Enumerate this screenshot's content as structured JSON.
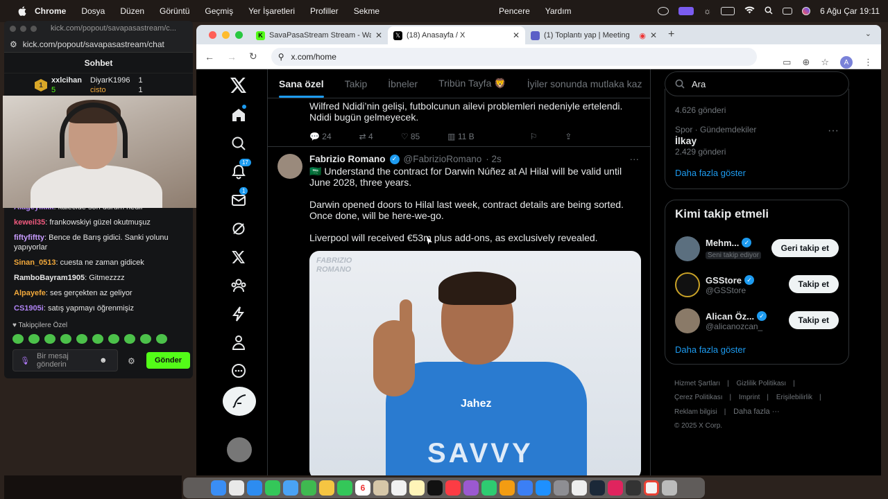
{
  "menubar": {
    "app": "Chrome",
    "items": [
      "Dosya",
      "Düzen",
      "Görüntü",
      "Geçmiş",
      "Yer İşaretleri",
      "Profiller",
      "Sekme"
    ],
    "right_items": [
      "Pencere",
      "Yardım"
    ],
    "datetime": "6 Ağu Çar  19:11"
  },
  "chat": {
    "window_title": "kick.com/popout/savapasastream/c...",
    "url": "kick.com/popout/savapasastream/chat",
    "header": "Sohbet",
    "leaderboard": [
      {
        "rank": "1",
        "name": "xxlcihan",
        "count": "5"
      },
      {
        "name": "DiyarK1996",
        "count": "1"
      },
      {
        "name": "cisto",
        "count": "1"
      }
    ],
    "messages": [
      {
        "user": "Alageyikkk",
        "text": "kalecide son durum nedir",
        "color": "#b084f5"
      },
      {
        "user": "keweil35",
        "text": "frankowskiyi güzel okutmuşuz",
        "color": "#f05a7e"
      },
      {
        "user": "fiftyfiftty",
        "text": "Bence de Barış gidici. Sanki yolunu yapıyorlar",
        "color": "#c89cff"
      },
      {
        "user": "Sinan_0513",
        "text": "cuesta ne zaman gidicek",
        "color": "#f2a93b"
      },
      {
        "user": "RamboBayram1905",
        "text": "Gitmezzzz",
        "color": "#e8e8e8"
      },
      {
        "user": "Alpayefe",
        "text": "ses gerçekten az geliyor",
        "color": "#f2a93b"
      },
      {
        "user": "CS1905i",
        "text": "satış yapmayı öğrenmişiz",
        "color": "#b084f5"
      }
    ],
    "followers_label": "Takipçilere Özel",
    "input_placeholder": "Bir mesaj gönderin",
    "send_label": "Gönder"
  },
  "browser": {
    "tabs": [
      {
        "title": "SavaPasaStream Stream - Wa",
        "icon": "kick-icon"
      },
      {
        "title": "(18) Anasayfa / X",
        "icon": "x-icon",
        "active": true
      },
      {
        "title": "(1) Toplantı yap | Meeting",
        "icon": "teams-icon"
      }
    ],
    "url": "x.com/home",
    "profile_initial": "A"
  },
  "x": {
    "nav_badges": {
      "notifications": "17",
      "messages": "1"
    },
    "feed_tabs": [
      "Sana özel",
      "Takip",
      "İbneler",
      "Tribün Tayfa 🦁",
      "İyiler sonunda mutlaka kaz"
    ],
    "prev_tweet": {
      "text": "Wilfred Ndidi’nin gelişi, futbolcunun ailevi problemleri nedeniyle ertelendi. Ndidi bugün gelmeyecek.",
      "replies": "24",
      "retweets": "4",
      "likes": "85",
      "views": "11 B"
    },
    "tweet": {
      "name": "Fabrizio Romano",
      "handle": "@FabrizioRomano",
      "time": "· 2s",
      "p1": "🇸🇦 Understand the contract for Darwin Núñez at Al Hilal will be valid until June 2028, three years.",
      "p2": "Darwin opened doors to Hilal last week, contract details are being sorted. Once done, will be here-we-go.",
      "p3": "Liverpool will received €53m plus add-ons, as exclusively revealed.",
      "watermark1": "FABRIZIO",
      "watermark2": "ROMANO",
      "jersey_text": "Jahez",
      "sponsor": "SAVVY"
    },
    "search_placeholder": "Ara",
    "trends": [
      {
        "count": "4.626 gönderi"
      },
      {
        "category": "Spor · Gündemdekiler",
        "name": "İlkay",
        "count": "2.429 gönderi"
      }
    ],
    "show_more": "Daha fazla göster",
    "who_to_follow": {
      "title": "Kimi takip etmeli",
      "people": [
        {
          "name": "Mehm...",
          "handle": "Seni takip ediyor",
          "button": "Geri takip et"
        },
        {
          "name": "GSStore",
          "handle": "@GSStore",
          "button": "Takip et"
        },
        {
          "name": "Alican Öz...",
          "handle": "@alicanozcan_",
          "button": "Takip et"
        }
      ],
      "show_more": "Daha fazla göster"
    },
    "footer": [
      "Hizmet Şartları",
      "Gizlilik Politikası",
      "Çerez Politikası",
      "Imprint",
      "Erişilebilirlik",
      "Reklam bilgisi",
      "Daha fazla ···",
      "© 2025 X Corp."
    ]
  },
  "dock": {
    "calendar_day": "6"
  }
}
